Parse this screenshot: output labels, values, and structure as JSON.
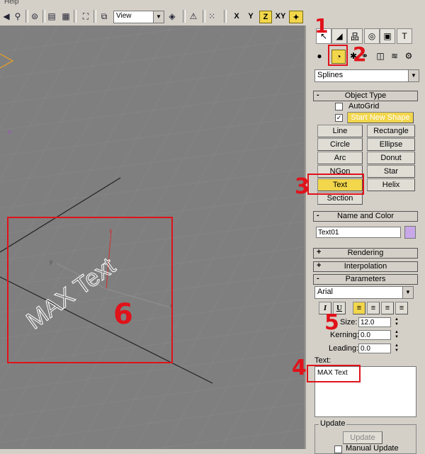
{
  "menu": {
    "help_label": "Help"
  },
  "toolbar": {
    "view_value": "View",
    "axes": [
      "X",
      "Y",
      "Z",
      "XY"
    ],
    "active_axis": "Z"
  },
  "panel": {
    "category_select": "Splines",
    "object_type": {
      "title": "Object Type",
      "autogrid_label": "AutoGrid",
      "start_new_shape_label": "Start New Shape",
      "buttons": [
        "Line",
        "Rectangle",
        "Circle",
        "Ellipse",
        "Arc",
        "Donut",
        "NGon",
        "Star",
        "Text",
        "Helix",
        "Section"
      ]
    },
    "name_and_color": {
      "title": "Name and Color",
      "name_value": "Text01",
      "swatch_color": "#c8a8e8"
    },
    "rendering": {
      "title": "Rendering"
    },
    "interpolation": {
      "title": "Interpolation"
    },
    "parameters": {
      "title": "Parameters",
      "font_value": "Arial",
      "size_label": "Size:",
      "size_value": "12.0",
      "kerning_label": "Kerning:",
      "kerning_value": "0.0",
      "leading_label": "Leading:",
      "leading_value": "0.0",
      "text_label": "Text:",
      "text_value": "MAX Text"
    },
    "update": {
      "group_label": "Update",
      "button_label": "Update",
      "manual_label": "Manual Update"
    }
  },
  "viewport": {
    "shape_text": "MAX Text",
    "axis_x": "x",
    "axis_y": "y",
    "axis_z": "z"
  },
  "annotations": {
    "n1": "1",
    "n2": "2",
    "n3": "3",
    "n4": "4",
    "n5": "5",
    "n6": "6"
  },
  "colors": {
    "annotation_red": "#e0121a",
    "highlight_yellow": "#f2d64b",
    "viewport_gray": "#7f7f7f"
  }
}
